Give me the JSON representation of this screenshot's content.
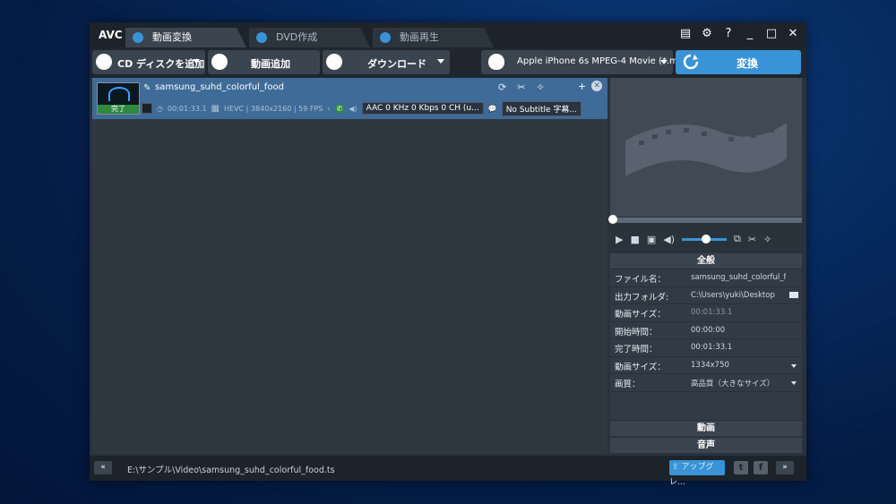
{
  "app": {
    "logo": "AVC"
  },
  "tabs": [
    {
      "label": "動画変換",
      "active": true
    },
    {
      "label": "DVD作成",
      "active": false
    },
    {
      "label": "動画再生",
      "active": false
    }
  ],
  "window_buttons": {
    "help": "?",
    "minimize": "_",
    "maximize": "□",
    "close": "✕"
  },
  "toolbar": {
    "cd_label": "CD ディスクを追加",
    "add_video_label": "動画追加",
    "download_label": "ダウンロード",
    "profile_label": "Apple iPhone 6s MPEG-4 Movie (*.m...",
    "convert_label": "変換"
  },
  "file": {
    "name": "samsung_suhd_colorful_food",
    "status": "完了",
    "duration": "00:01:33.1",
    "video_info": "HEVC | 3840x2160 | 59 FPS",
    "audio": "AAC 0 KHz 0 Kbps 0 CH (u...",
    "subtitle": "No Subtitle 字幕..."
  },
  "props": {
    "header": "全般",
    "rows": [
      {
        "key": "ファイル名：",
        "value": "samsung_suhd_colorful_fo..."
      },
      {
        "key": "出力フォルダ:",
        "value": "C:\\Users\\yuki\\Desktop"
      },
      {
        "key": "動画サイズ：",
        "value": "00:01:33.1"
      },
      {
        "key": "開始時間：",
        "value": "00:00:00"
      },
      {
        "key": "完了時間：",
        "value": "00:01:33.1"
      },
      {
        "key": "動画サイズ：",
        "value": "1334x750"
      },
      {
        "key": "画質：",
        "value": "高品質（大きなサイズ）"
      }
    ],
    "video_section": "動画",
    "audio_section": "音声"
  },
  "statusbar": {
    "path": "E:\\サンプル\\Video\\samsung_suhd_colorful_food.ts",
    "upgrade_label": "アップグレ...",
    "prev": "«",
    "next": "»"
  },
  "colors": {
    "accent": "#3a93d6",
    "selected_row": "#3f6b98",
    "done": "#2d8a3e"
  }
}
